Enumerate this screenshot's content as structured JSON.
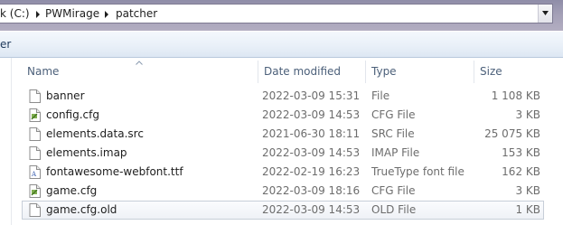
{
  "address_bar": {
    "segments": [
      "k (C:)",
      "PWMirage",
      "patcher"
    ]
  },
  "command_bar": {
    "partial_label": "er"
  },
  "columns": [
    {
      "key": "name",
      "label": "Name"
    },
    {
      "key": "date",
      "label": "Date modified"
    },
    {
      "key": "type",
      "label": "Type"
    },
    {
      "key": "size",
      "label": "Size"
    }
  ],
  "sort": {
    "column": "name",
    "direction": "ascending",
    "icon": "sort-up-chevron-icon"
  },
  "files": [
    {
      "name": "banner",
      "date": "2022-03-09 15:31",
      "type": "File",
      "size": "1 108 KB",
      "icon": "blank-file-icon"
    },
    {
      "name": "config.cfg",
      "date": "2022-03-09 14:53",
      "type": "CFG File",
      "size": "3 KB",
      "icon": "settings-file-icon"
    },
    {
      "name": "elements.data.src",
      "date": "2021-06-30 18:11",
      "type": "SRC File",
      "size": "25 075 KB",
      "icon": "blank-file-icon"
    },
    {
      "name": "elements.imap",
      "date": "2022-03-09 14:53",
      "type": "IMAP File",
      "size": "153 KB",
      "icon": "blank-file-icon"
    },
    {
      "name": "fontawesome-webfont.ttf",
      "date": "2022-02-19 16:23",
      "type": "TrueType font file",
      "size": "162 KB",
      "icon": "font-file-icon"
    },
    {
      "name": "game.cfg",
      "date": "2022-03-09 18:16",
      "type": "CFG File",
      "size": "3 KB",
      "icon": "settings-file-icon"
    },
    {
      "name": "game.cfg.old",
      "date": "2022-03-09 14:53",
      "type": "OLD File",
      "size": "1 KB",
      "icon": "blank-file-icon",
      "hovered": true
    }
  ],
  "colors": {
    "title_gradient": "#a39fb6",
    "header_text": "#4c607a",
    "secondary_text": "#6d6d6d"
  }
}
